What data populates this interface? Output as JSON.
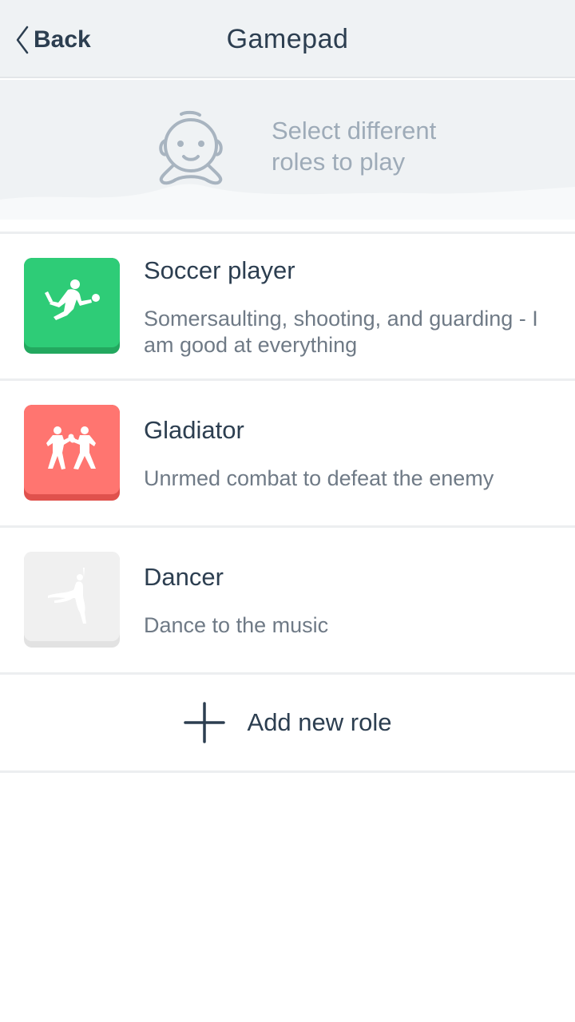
{
  "header": {
    "back_label": "Back",
    "title": "Gamepad",
    "back_icon": "chevron-left-icon"
  },
  "banner": {
    "text": "Select different roles to play",
    "icon": "robot-head-icon"
  },
  "roles": [
    {
      "name": "Soccer player",
      "description": "Somersaulting, shooting, and guarding - I am good at everything",
      "icon": "soccer-kick-icon",
      "color": "#2ecc77",
      "shadow": "#23a85f"
    },
    {
      "name": "Gladiator",
      "description": "Unrmed combat to defeat the enemy",
      "icon": "boxing-icon",
      "color": "#ff7570",
      "shadow": "#e0514d"
    },
    {
      "name": "Dancer",
      "description": "Dance to the music",
      "icon": "ballet-dancer-icon",
      "color": "#f0f0f0",
      "shadow": "#e2e2e2"
    }
  ],
  "add_role": {
    "label": "Add new role",
    "icon": "plus-icon"
  }
}
